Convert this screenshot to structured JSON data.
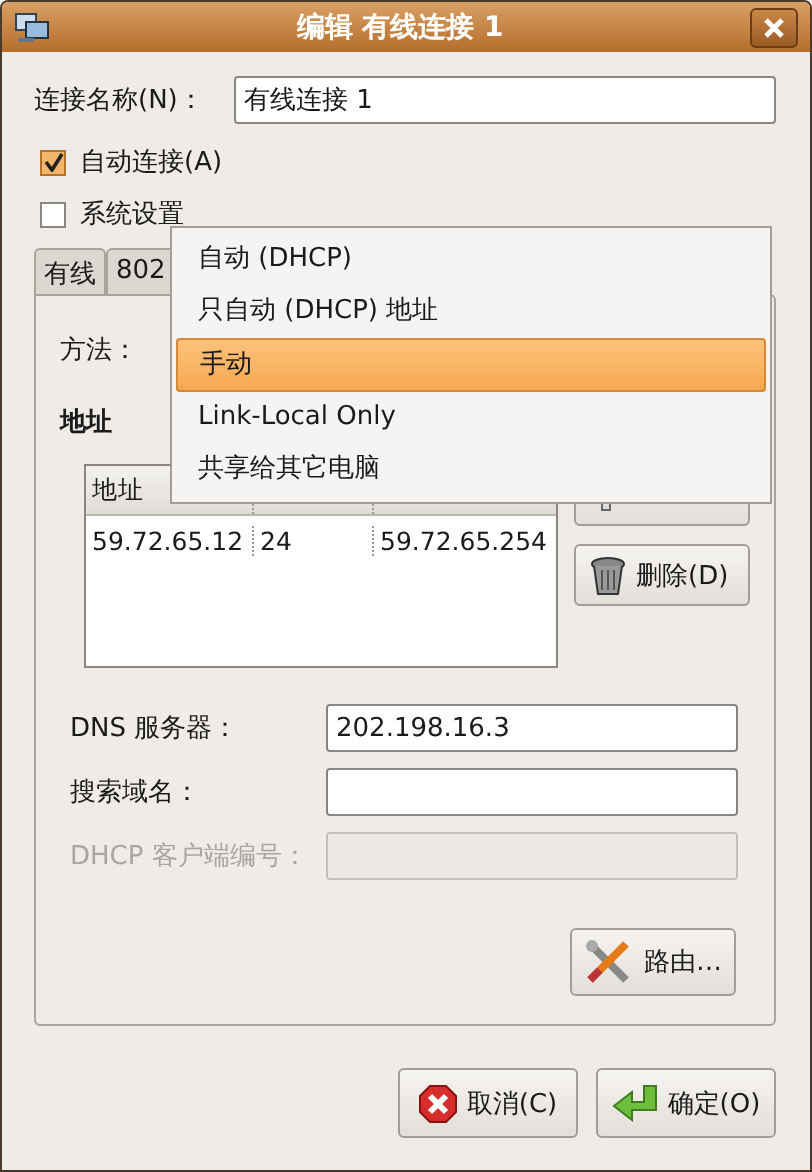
{
  "window": {
    "title": "编辑 有线连接 1"
  },
  "connection_name": {
    "label": "连接名称(N)：",
    "value": "有线连接 1"
  },
  "checkboxes": [
    {
      "label": "自动连接(A)",
      "checked": true
    },
    {
      "label": "系统设置",
      "checked": false
    }
  ],
  "tabs": [
    {
      "label": "有线",
      "selected": false
    },
    {
      "label": "802",
      "selected": false
    }
  ],
  "method": {
    "label": "方法："
  },
  "addresses": {
    "title": "地址",
    "columns": [
      {
        "label": "地址"
      }
    ],
    "rows": [
      [
        "59.72.65.12",
        "24",
        "59.72.65.254"
      ]
    ],
    "buttons": [
      {
        "kind": "add"
      },
      {
        "kind": "delete",
        "label": "删除(D)"
      }
    ]
  },
  "fields": [
    {
      "label": "DNS 服务器：",
      "value": "202.198.16.3",
      "disabled": false
    },
    {
      "label": "搜索域名：",
      "disabled": false
    },
    {
      "label": "DHCP 客户端编号：",
      "disabled": true
    }
  ],
  "routes_button": {
    "label": "路由…"
  },
  "dialog_buttons": [
    {
      "kind": "cancel",
      "label": "取消(C)"
    },
    {
      "kind": "ok",
      "label": "确定(O)"
    }
  ],
  "method_menu": {
    "items": [
      {
        "label": "自动 (DHCP)",
        "selected": false
      },
      {
        "label": "只自动 (DHCP) 地址",
        "selected": false
      },
      {
        "label": "手动",
        "selected": true
      },
      {
        "label": "Link-Local Only",
        "selected": false
      },
      {
        "label": "共享给其它电脑",
        "selected": false
      }
    ]
  }
}
